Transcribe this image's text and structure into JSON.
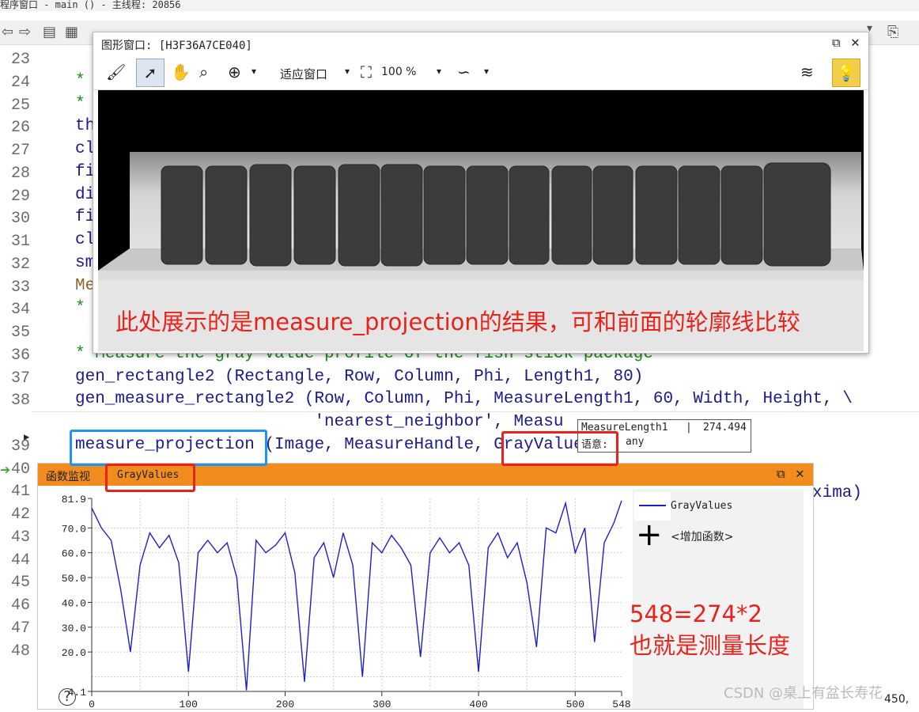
{
  "editor": {
    "title_text": "程序窗口 - main () - 主线程: 20856",
    "code_lines": [
      {
        "n": "23",
        "text": "",
        "cls": ""
      },
      {
        "n": "24",
        "text": "*",
        "cls": "cm"
      },
      {
        "n": "25",
        "text": "*",
        "cls": "cm"
      },
      {
        "n": "26",
        "text": "th",
        "cls": ""
      },
      {
        "n": "27",
        "text": "cl",
        "cls": ""
      },
      {
        "n": "28",
        "text": "fi",
        "cls": ""
      },
      {
        "n": "29",
        "text": "di",
        "cls": ""
      },
      {
        "n": "30",
        "text": "fi",
        "cls": ""
      },
      {
        "n": "31",
        "text": "cl",
        "cls": ""
      },
      {
        "n": "32",
        "text": "sm",
        "cls": ""
      },
      {
        "n": "33",
        "text": "Me",
        "cls": "mr"
      },
      {
        "n": "34",
        "text": "*",
        "cls": "cm"
      },
      {
        "n": "35",
        "text": "",
        "cls": ""
      },
      {
        "n": "36",
        "text": "* Measure the gray value profile of the fish stick package",
        "cls": "cm"
      },
      {
        "n": "37",
        "text": "gen_rectangle2 (Rectangle, Row, Column, Phi, Length1, 80)",
        "cls": ""
      },
      {
        "n": "38",
        "text": "gen_measure_rectangle2 (Row, Column, Phi, MeasureLength1, 60, Width, Height, \\",
        "cls": ""
      },
      {
        "n": "",
        "text": "                        'nearest_neighbor', Measu",
        "cls": ""
      },
      {
        "n": "39",
        "text": "measure_projection (Image, MeasureHandle, GrayValues",
        "cls": ""
      },
      {
        "n": "40",
        "text": "",
        "cls": ""
      },
      {
        "n": "41",
        "text": "",
        "cls": ""
      },
      {
        "n": "42",
        "text": "",
        "cls": ""
      },
      {
        "n": "43",
        "text": "",
        "cls": ""
      },
      {
        "n": "44",
        "text": "",
        "cls": ""
      },
      {
        "n": "45",
        "text": "",
        "cls": ""
      },
      {
        "n": "46",
        "text": "",
        "cls": ""
      },
      {
        "n": "47",
        "text": "",
        "cls": ""
      },
      {
        "n": "48",
        "text": "",
        "cls": ""
      }
    ],
    "line41_tail": "xima)"
  },
  "graphics_window": {
    "title": "图形窗口: [H3F36A7CE040]",
    "fit_label": "适应窗口",
    "zoom_label": "100 %",
    "annotation": "此处展示的是measure_projection的结果，可和前面的轮廓线比较"
  },
  "tooltip": {
    "name": "MeasureLength1",
    "value": "274.494",
    "semantics_label": "语意:",
    "semantics_value": "any"
  },
  "function_monitor": {
    "title": "函数监视",
    "var": "GrayValues",
    "legend_series": "GrayValues",
    "add_label": "<增加函数>",
    "annotation_line1": "548=274*2",
    "annotation_line2": "也就是测量长度"
  },
  "chart_data": {
    "type": "line",
    "series": [
      {
        "name": "GrayValues",
        "color": "#1f1fc8"
      }
    ],
    "x": [
      0,
      10,
      20,
      30,
      40,
      50,
      60,
      70,
      80,
      90,
      100,
      110,
      120,
      130,
      140,
      150,
      160,
      170,
      180,
      190,
      200,
      210,
      220,
      230,
      240,
      250,
      260,
      270,
      280,
      290,
      300,
      310,
      320,
      330,
      340,
      350,
      360,
      370,
      380,
      390,
      400,
      410,
      420,
      430,
      440,
      450,
      460,
      470,
      480,
      490,
      500,
      510,
      520,
      530,
      540,
      548
    ],
    "y": [
      78,
      70,
      65,
      45,
      20,
      55,
      68,
      62,
      67,
      56,
      12,
      60,
      65,
      60,
      64,
      50,
      4.5,
      65,
      60,
      63,
      68,
      52,
      8,
      58,
      64,
      50,
      68,
      55,
      10,
      64,
      60,
      67,
      62,
      55,
      18,
      60,
      66,
      60,
      64,
      55,
      12,
      62,
      68,
      58,
      64,
      48,
      22,
      70,
      68,
      80,
      60,
      70,
      24,
      64,
      72,
      81
    ],
    "xlim": [
      0,
      548
    ],
    "ylim": [
      4.1,
      81.9
    ],
    "yticks": [
      "81.9",
      "70.0",
      "60.0",
      "50.0",
      "40.0",
      "30.0",
      "20.0",
      "4.1"
    ],
    "xticks": [
      "0",
      "100",
      "200",
      "300",
      "400",
      "500",
      "548"
    ]
  },
  "watermark": "CSDN @桌上有盆长寿花",
  "status_coord": "450,"
}
